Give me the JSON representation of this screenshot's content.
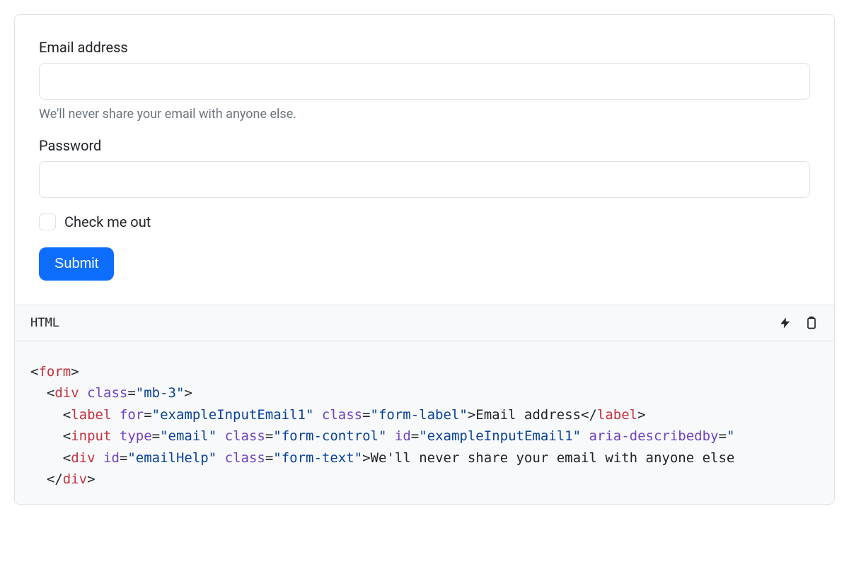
{
  "form": {
    "email_label": "Email address",
    "email_help": "We'll never share your email with anyone else.",
    "password_label": "Password",
    "check_label": "Check me out",
    "submit_label": "Submit"
  },
  "code_header": {
    "lang_label": "HTML"
  },
  "code": {
    "l1_tag": "form",
    "l2_tag": "div",
    "l2_attr_class": "class",
    "l2_val_class": "\"mb-3\"",
    "l3_tag": "label",
    "l3_attr_for": "for",
    "l3_val_for": "\"exampleInputEmail1\"",
    "l3_attr_class": "class",
    "l3_val_class": "\"form-label\"",
    "l3_text": "Email address",
    "l3_close_tag": "label",
    "l4_tag": "input",
    "l4_attr_type": "type",
    "l4_val_type": "\"email\"",
    "l4_attr_class": "class",
    "l4_val_class": "\"form-control\"",
    "l4_attr_id": "id",
    "l4_val_id": "\"exampleInputEmail1\"",
    "l4_attr_aria": "aria-describedby",
    "l4_val_aria": "\"",
    "l5_tag": "div",
    "l5_attr_id": "id",
    "l5_val_id": "\"emailHelp\"",
    "l5_attr_class": "class",
    "l5_val_class": "\"form-text\"",
    "l5_text": "We'll never share your email with anyone else",
    "l6_close_tag": "div"
  }
}
